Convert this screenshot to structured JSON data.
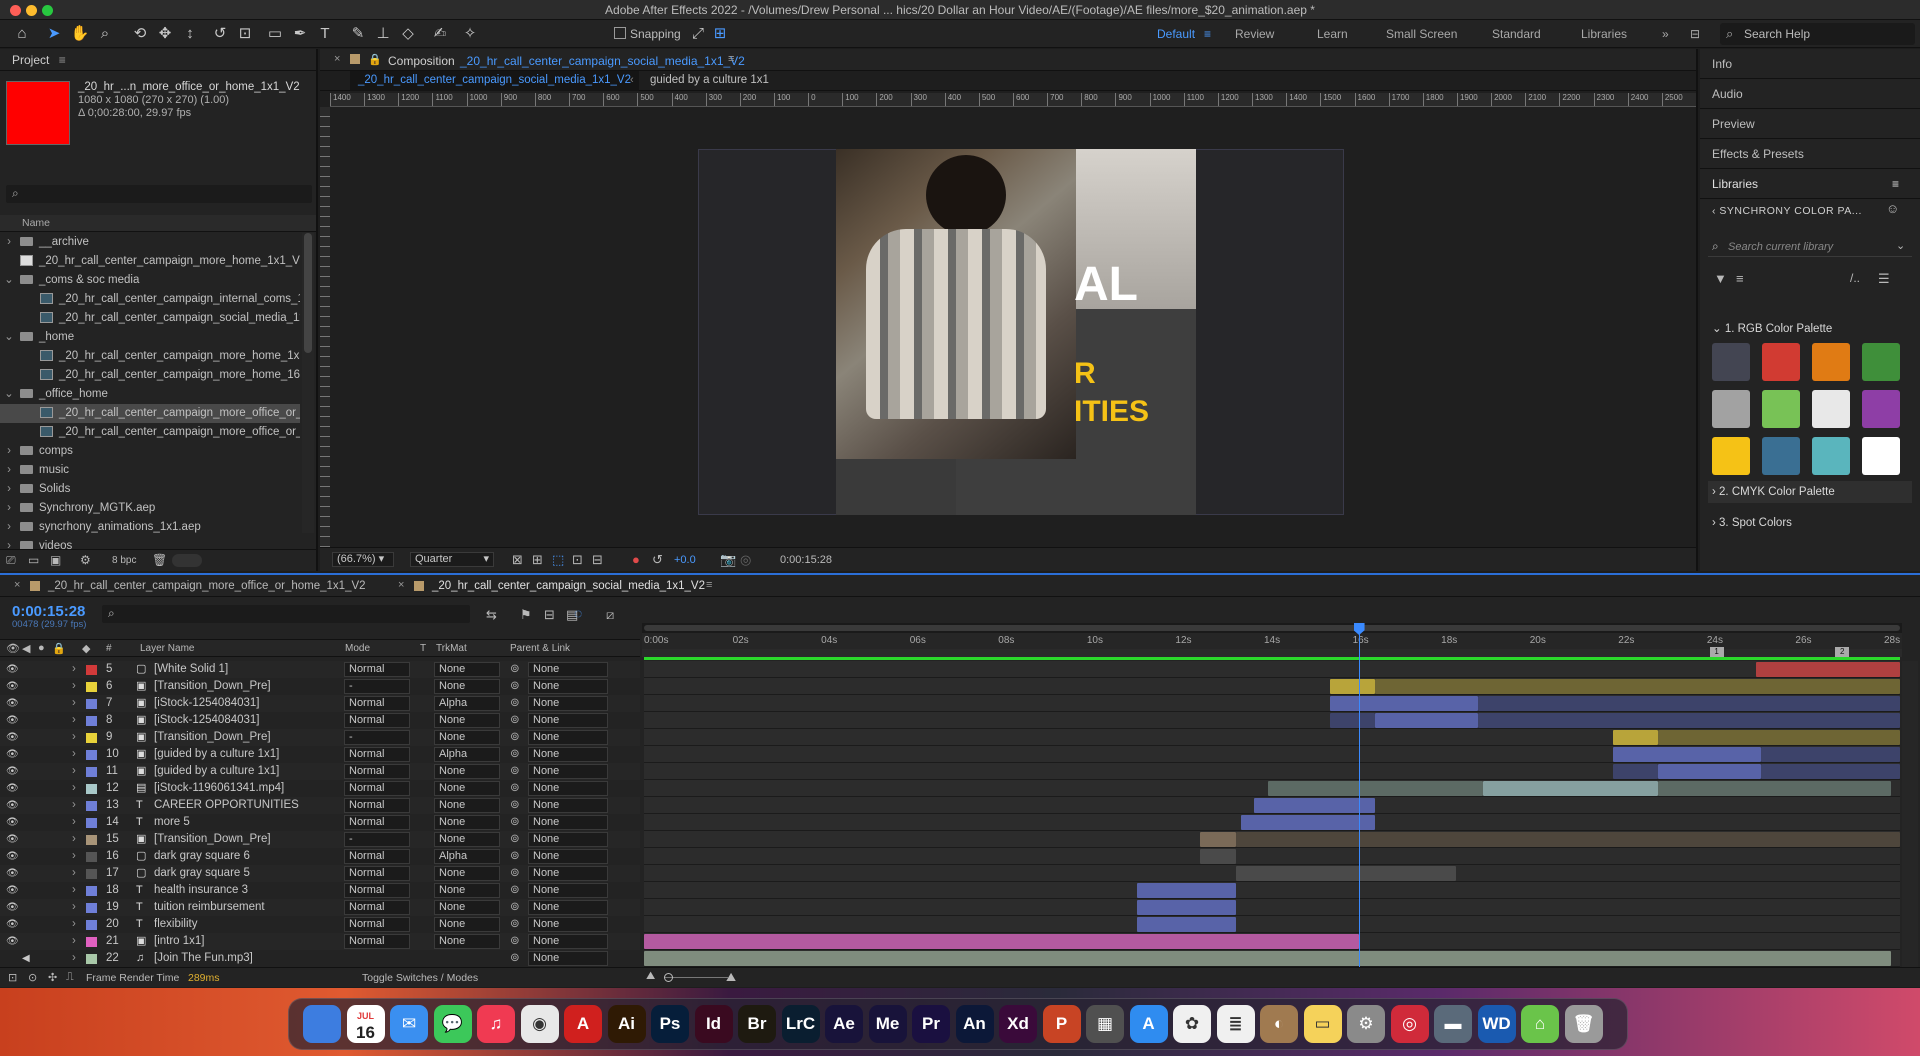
{
  "app": {
    "title": "Adobe After Effects 2022 - /Volumes/Drew Personal ... hics/20 Dollar an Hour Video/AE/(Footage)/AE files/more_$20_animation.aep *"
  },
  "toolbar": {
    "snapping": "Snapping",
    "workspaces": [
      "Default",
      "Review",
      "Learn",
      "Small Screen",
      "Standard",
      "Libraries"
    ],
    "search": "Search Help"
  },
  "project": {
    "title": "Project",
    "item_name": "_20_hr_...n_more_office_or_home_1x1_V2",
    "item_dims": "1080 x 1080  (270 x 270) (1.00)",
    "item_dur": "Δ 0;00:28:00, 29.97 fps",
    "col_name": "Name",
    "bpc": "8 bpc",
    "items": [
      {
        "name": "__archive",
        "type": "folder",
        "indent": 0,
        "open": false,
        "selected": false
      },
      {
        "name": "_20_hr_call_center_campaign_more_home_1x1_V2_",
        "type": "file",
        "indent": 0,
        "open": false,
        "selected": false
      },
      {
        "name": "_coms & soc media",
        "type": "folder",
        "indent": 0,
        "open": true,
        "selected": false
      },
      {
        "name": "_20_hr_call_center_campaign_internal_coms_1x1",
        "type": "comp",
        "indent": 1,
        "open": false,
        "selected": false
      },
      {
        "name": "_20_hr_call_center_campaign_social_media_1x1",
        "type": "comp",
        "indent": 1,
        "open": false,
        "selected": false
      },
      {
        "name": "_home",
        "type": "folder",
        "indent": 0,
        "open": true,
        "selected": false
      },
      {
        "name": "_20_hr_call_center_campaign_more_home_1x1_",
        "type": "comp",
        "indent": 1,
        "open": false,
        "selected": false
      },
      {
        "name": "_20_hr_call_center_campaign_more_home_16x9",
        "type": "comp",
        "indent": 1,
        "open": false,
        "selected": false
      },
      {
        "name": "_office_home",
        "type": "folder",
        "indent": 0,
        "open": true,
        "selected": false
      },
      {
        "name": "_20_hr_call_center_campaign_more_office_or_",
        "type": "comp",
        "indent": 1,
        "open": false,
        "selected": true
      },
      {
        "name": "_20_hr_call_center_campaign_more_office_or_ho",
        "type": "comp",
        "indent": 1,
        "open": false,
        "selected": false
      },
      {
        "name": "comps",
        "type": "folder",
        "indent": 0,
        "open": false,
        "selected": false
      },
      {
        "name": "music",
        "type": "folder",
        "indent": 0,
        "open": false,
        "selected": false
      },
      {
        "name": "Solids",
        "type": "folder",
        "indent": 0,
        "open": false,
        "selected": false
      },
      {
        "name": "Synchrony_MGTK.aep",
        "type": "folder",
        "indent": 0,
        "open": false,
        "selected": false
      },
      {
        "name": "syncrhony_animations_1x1.aep",
        "type": "folder",
        "indent": 0,
        "open": false,
        "selected": false
      },
      {
        "name": "videos",
        "type": "folder",
        "indent": 0,
        "open": false,
        "selected": false
      }
    ]
  },
  "composition": {
    "label": "Composition",
    "name": "_20_hr_call_center_campaign_social_media_1x1_V2",
    "crumb_active": "_20_hr_call_center_campaign_social_media_1x1_V2",
    "crumb_next": "guided by a culture 1x1",
    "text_a": "AL",
    "text_b": "R",
    "text_c": "ITIES",
    "zoom": "(66.7%)",
    "resolution": "Quarter",
    "exposure": "+0.0",
    "timecode": "0:00:15:28",
    "ruler": [
      "1400",
      "1300",
      "1200",
      "1100",
      "1000",
      "900",
      "800",
      "700",
      "600",
      "500",
      "400",
      "300",
      "200",
      "100",
      "0",
      "100",
      "200",
      "300",
      "400",
      "500",
      "600",
      "700",
      "800",
      "900",
      "1000",
      "1100",
      "1200",
      "1300",
      "1400",
      "1500",
      "1600",
      "1700",
      "1800",
      "1900",
      "2000",
      "2100",
      "2200",
      "2300",
      "2400",
      "2500"
    ]
  },
  "right": {
    "panels": [
      "Info",
      "Audio",
      "Preview",
      "Effects & Presets"
    ],
    "libraries": "Libraries",
    "library_name": "SYNCHRONY COLOR PA...",
    "search": "Search current library",
    "group1": "1. RGB Color Palette",
    "group2": "2. CMYK Color Palette",
    "group3": "3. Spot Colors",
    "swatches": [
      "#434552",
      "#d13b32",
      "#e07b14",
      "#3f8f3a",
      "#a2a2a2",
      "#78c256",
      "#e8e8e8",
      "#8e3ea6",
      "#f5c216",
      "#3a6f93",
      "#5ab5bd",
      "#ffffff"
    ]
  },
  "timeline": {
    "tab1": "_20_hr_call_center_campaign_more_office_or_home_1x1_V2",
    "tab2": "_20_hr_call_center_campaign_social_media_1x1_V2",
    "timecode": "0:00:15:28",
    "frames": "00478 (29.97 fps)",
    "headers": {
      "layer": "Layer Name",
      "mode": "Mode",
      "t": "T",
      "trkmat": "TrkMat",
      "parent": "Parent & Link"
    },
    "ticks": [
      "0:00s",
      "02s",
      "04s",
      "06s",
      "08s",
      "10s",
      "12s",
      "14s",
      "16s",
      "18s",
      "20s",
      "22s",
      "24s",
      "26s",
      "28s"
    ],
    "marker1": "1",
    "marker2": "2",
    "frame_render_label": "Frame Render Time",
    "frame_render_value": "289ms",
    "toggle": "Toggle Switches / Modes",
    "playhead_s": 15.93,
    "duration_s": 28,
    "layers": [
      {
        "num": "5",
        "name": "[White Solid 1]",
        "color": "#d23a3a",
        "icon": "solid",
        "mode": "Normal",
        "trk": "None",
        "parent": "None",
        "bars": [
          {
            "s": 24.8,
            "e": 28,
            "c": "#b04040"
          }
        ]
      },
      {
        "num": "6",
        "name": "[Transition_Down_Pre]",
        "color": "#e8d23a",
        "icon": "precomp",
        "mode": "-",
        "trk": "None",
        "parent": "None",
        "bars": [
          {
            "s": 15.3,
            "e": 16.3,
            "c": "#b8a43a"
          },
          {
            "s": 16.3,
            "e": 28,
            "c": "#6e6534"
          }
        ]
      },
      {
        "num": "7",
        "name": "[iStock-1254084031]",
        "color": "#6f7fd8",
        "icon": "precomp",
        "mode": "Normal",
        "trk": "Alpha",
        "parent": "None",
        "bars": [
          {
            "s": 15.3,
            "e": 18.6,
            "c": "#5863a8"
          },
          {
            "s": 18.6,
            "e": 28,
            "c": "#3d436a"
          }
        ]
      },
      {
        "num": "8",
        "name": "[iStock-1254084031]",
        "color": "#6f7fd8",
        "icon": "precomp",
        "mode": "Normal",
        "trk": "None",
        "parent": "None",
        "bars": [
          {
            "s": 15.3,
            "e": 16.3,
            "c": "#3d436a"
          },
          {
            "s": 16.3,
            "e": 18.6,
            "c": "#5863a8"
          },
          {
            "s": 18.6,
            "e": 28,
            "c": "#3d436a"
          }
        ]
      },
      {
        "num": "9",
        "name": "[Transition_Down_Pre]",
        "color": "#e8d23a",
        "icon": "precomp",
        "mode": "-",
        "trk": "None",
        "parent": "None",
        "bars": [
          {
            "s": 21.6,
            "e": 22.6,
            "c": "#b8a43a"
          },
          {
            "s": 22.6,
            "e": 28,
            "c": "#6e6534"
          }
        ]
      },
      {
        "num": "10",
        "name": "[guided by a culture 1x1]",
        "color": "#6f7fd8",
        "icon": "precomp",
        "mode": "Normal",
        "trk": "Alpha",
        "parent": "None",
        "bars": [
          {
            "s": 21.6,
            "e": 24.9,
            "c": "#5863a8"
          },
          {
            "s": 24.9,
            "e": 28,
            "c": "#3d436a"
          }
        ]
      },
      {
        "num": "11",
        "name": "[guided by a culture 1x1]",
        "color": "#6f7fd8",
        "icon": "precomp",
        "mode": "Normal",
        "trk": "None",
        "parent": "None",
        "bars": [
          {
            "s": 21.6,
            "e": 22.6,
            "c": "#3d436a"
          },
          {
            "s": 22.6,
            "e": 24.9,
            "c": "#5863a8"
          },
          {
            "s": 24.9,
            "e": 28,
            "c": "#3d436a"
          }
        ]
      },
      {
        "num": "12",
        "name": "[iStock-1196061341.mp4]",
        "color": "#a8c8c8",
        "icon": "file",
        "mode": "Normal",
        "trk": "None",
        "parent": "None",
        "bars": [
          {
            "s": 13.9,
            "e": 18.7,
            "c": "#5c6a64"
          },
          {
            "s": 18.7,
            "e": 22.6,
            "c": "#86a0a0"
          },
          {
            "s": 22.6,
            "e": 27.8,
            "c": "#5c6a64"
          }
        ]
      },
      {
        "num": "13",
        "name": "CAREER OPPORTUNITIES",
        "color": "#6f7fd8",
        "icon": "text",
        "mode": "Normal",
        "trk": "None",
        "parent": "None",
        "bars": [
          {
            "s": 13.6,
            "e": 16.3,
            "c": "#5863a8"
          }
        ]
      },
      {
        "num": "14",
        "name": "more 5",
        "color": "#6f7fd8",
        "icon": "text",
        "mode": "Normal",
        "trk": "None",
        "parent": "None",
        "bars": [
          {
            "s": 13.3,
            "e": 16.3,
            "c": "#5863a8"
          }
        ]
      },
      {
        "num": "15",
        "name": "[Transition_Down_Pre]",
        "color": "#a89478",
        "icon": "precomp",
        "mode": "-",
        "trk": "None",
        "parent": "None",
        "bars": [
          {
            "s": 12.4,
            "e": 13.2,
            "c": "#7a6a58"
          },
          {
            "s": 13.2,
            "e": 28,
            "c": "#4e463c"
          }
        ]
      },
      {
        "num": "16",
        "name": "dark gray square 6",
        "color": "#555555",
        "icon": "solid",
        "mode": "Normal",
        "trk": "Alpha",
        "parent": "None",
        "bars": [
          {
            "s": 12.4,
            "e": 13.2,
            "c": "#4a4a4a"
          }
        ]
      },
      {
        "num": "17",
        "name": "dark gray square 5",
        "color": "#555555",
        "icon": "solid",
        "mode": "Normal",
        "trk": "None",
        "parent": "None",
        "bars": [
          {
            "s": 13.2,
            "e": 18.1,
            "c": "#4a4a4a"
          }
        ]
      },
      {
        "num": "18",
        "name": "health insurance 3",
        "color": "#6f7fd8",
        "icon": "text",
        "mode": "Normal",
        "trk": "None",
        "parent": "None",
        "bars": [
          {
            "s": 11,
            "e": 13.2,
            "c": "#5863a8"
          }
        ]
      },
      {
        "num": "19",
        "name": "tuition reimbursement",
        "color": "#6f7fd8",
        "icon": "text",
        "mode": "Normal",
        "trk": "None",
        "parent": "None",
        "bars": [
          {
            "s": 11,
            "e": 13.2,
            "c": "#5863a8"
          }
        ]
      },
      {
        "num": "20",
        "name": "flexibility",
        "color": "#6f7fd8",
        "icon": "text",
        "mode": "Normal",
        "trk": "None",
        "parent": "None",
        "bars": [
          {
            "s": 11,
            "e": 13.2,
            "c": "#5863a8"
          }
        ]
      },
      {
        "num": "21",
        "name": "[intro 1x1]",
        "color": "#e060c0",
        "icon": "precomp",
        "mode": "Normal",
        "trk": "None",
        "parent": "None",
        "bars": [
          {
            "s": 0,
            "e": 15.95,
            "c": "#b45aa0"
          }
        ]
      },
      {
        "num": "22",
        "name": "[Join The Fun.mp3]",
        "color": "#a8c8a8",
        "icon": "audio",
        "mode": "",
        "trk": "",
        "parent": "None",
        "bars": [
          {
            "s": 0,
            "e": 27.8,
            "c": "#7f8c7e"
          }
        ]
      }
    ]
  },
  "dock": {
    "date_month": "JUL",
    "date_day": "16",
    "apps": [
      {
        "label": "",
        "bg": "#3d7de0",
        "name": "finder-icon"
      },
      {
        "label": "",
        "bg": "#ffffff",
        "name": "calendar-icon"
      },
      {
        "label": "✉",
        "bg": "#3a8ff0",
        "name": "mail-icon"
      },
      {
        "label": "💬",
        "bg": "#3cc85a",
        "name": "messages-icon"
      },
      {
        "label": "♫",
        "bg": "#f03a52",
        "name": "music-icon"
      },
      {
        "label": "◉",
        "bg": "#e8e8e8",
        "name": "chrome-icon"
      },
      {
        "label": "A",
        "bg": "#d0201e",
        "name": "acrobat-icon"
      },
      {
        "label": "Ai",
        "bg": "#2f1a04",
        "name": "illustrator-icon"
      },
      {
        "label": "Ps",
        "bg": "#061e3a",
        "name": "photoshop-icon"
      },
      {
        "label": "Id",
        "bg": "#3a0a20",
        "name": "indesign-icon"
      },
      {
        "label": "Br",
        "bg": "#1e1a10",
        "name": "bridge-icon"
      },
      {
        "label": "LrC",
        "bg": "#0a1e30",
        "name": "lightroom-icon"
      },
      {
        "label": "Ae",
        "bg": "#18133a",
        "name": "aftereffects-icon"
      },
      {
        "label": "Me",
        "bg": "#18133a",
        "name": "mediaencoder-icon"
      },
      {
        "label": "Pr",
        "bg": "#1a1040",
        "name": "premiere-icon"
      },
      {
        "label": "An",
        "bg": "#0c1838",
        "name": "animate-icon"
      },
      {
        "label": "Xd",
        "bg": "#3a0a3a",
        "name": "xd-icon"
      },
      {
        "label": "P",
        "bg": "#c84424",
        "name": "powerpoint-icon"
      },
      {
        "label": "▦",
        "bg": "#505050",
        "name": "calculator-icon"
      },
      {
        "label": "A",
        "bg": "#2f8cf0",
        "name": "appstore-icon"
      },
      {
        "label": "✿",
        "bg": "#f0f0f0",
        "name": "photos-icon"
      },
      {
        "label": "≣",
        "bg": "#f0f0f0",
        "name": "reminders-icon"
      },
      {
        "label": "◐",
        "bg": "#a07a50",
        "name": "contacts-icon"
      },
      {
        "label": "▭",
        "bg": "#f5d25a",
        "name": "notes-icon"
      },
      {
        "label": "⚙",
        "bg": "#8a8a8a",
        "name": "settings-icon"
      },
      {
        "label": "◎",
        "bg": "#d02a3a",
        "name": "creativecloud-icon"
      },
      {
        "label": "▬",
        "bg": "#5a6a7a",
        "name": "scanner-icon"
      },
      {
        "label": "WD",
        "bg": "#1a5ab0",
        "name": "wd-icon"
      },
      {
        "label": "⌂",
        "bg": "#6ac44a",
        "name": "home-icon"
      },
      {
        "label": "🗑",
        "bg": "#9a9a9a",
        "name": "trash-icon"
      }
    ]
  }
}
